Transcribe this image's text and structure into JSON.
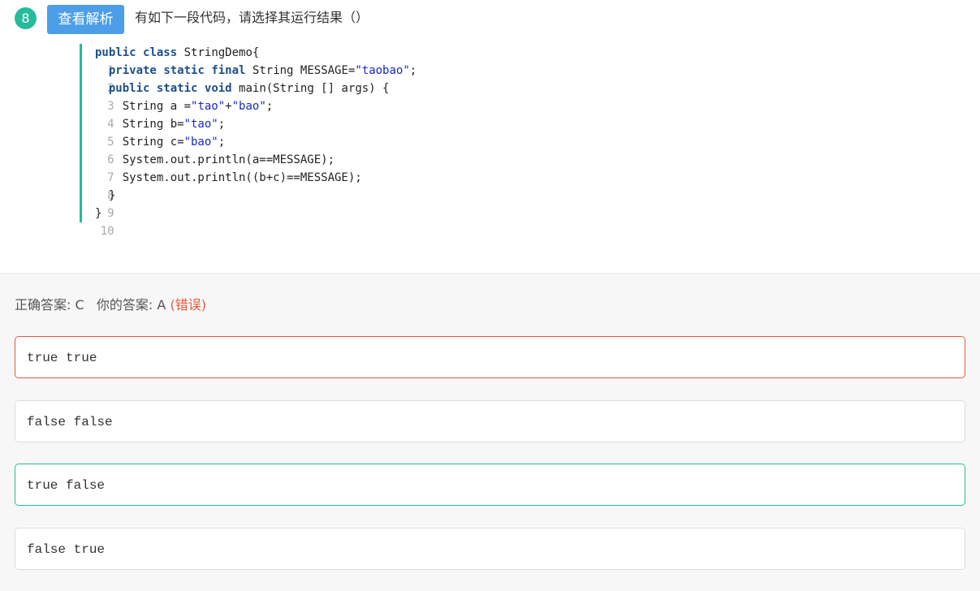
{
  "question": {
    "number": "8",
    "analysis_button": "查看解析",
    "text": "有如下一段代码，请选择其运行结果（）"
  },
  "code": {
    "lines": [
      {
        "n": "1"
      },
      {
        "n": "2"
      },
      {
        "n": "3"
      },
      {
        "n": "4"
      },
      {
        "n": "5"
      },
      {
        "n": "6"
      },
      {
        "n": "7"
      },
      {
        "n": "8"
      },
      {
        "n": "9"
      },
      {
        "n": "10"
      }
    ],
    "text": [
      "public class StringDemo{",
      "  private static final String MESSAGE=\"taobao\";",
      "  public static void main(String [] args) {",
      "    String a =\"tao\"+\"bao\";",
      "    String b=\"tao\";",
      "    String c=\"bao\";",
      "    System.out.println(a==MESSAGE);",
      "    System.out.println((b+c)==MESSAGE);",
      "  }",
      "}"
    ]
  },
  "result": {
    "correct_label": "正确答案: C",
    "your_label": "你的答案: A",
    "status": "(错误)"
  },
  "colors": {
    "accent": "#25bb9b",
    "button": "#4c9ee8",
    "error": "#e5593f"
  },
  "options": [
    {
      "text": "true true",
      "state": "chosen-wrong"
    },
    {
      "text": "false false",
      "state": ""
    },
    {
      "text": "true false",
      "state": "correct"
    },
    {
      "text": "false true",
      "state": ""
    }
  ]
}
